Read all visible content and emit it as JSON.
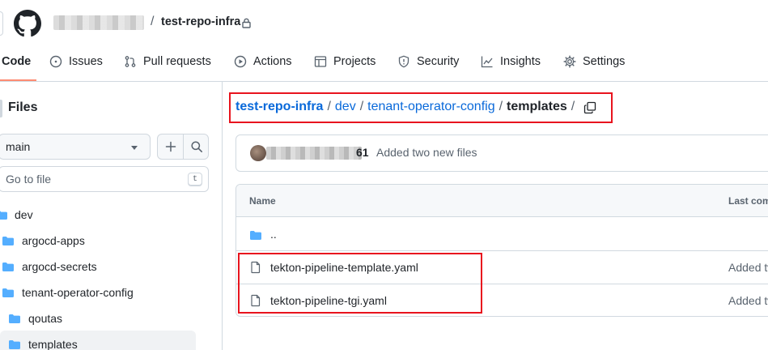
{
  "header": {
    "owner_blurred": "",
    "separator": "/",
    "repo_name": "test-repo-infra"
  },
  "nav": {
    "code": "Code",
    "issues": "Issues",
    "pull_requests": "Pull requests",
    "actions": "Actions",
    "projects": "Projects",
    "security": "Security",
    "insights": "Insights",
    "settings": "Settings"
  },
  "sidebar": {
    "title": "Files",
    "branch": "main",
    "goto_placeholder": "Go to file",
    "goto_shortcut": "t",
    "tree": [
      {
        "label": "dev"
      },
      {
        "label": "argocd-apps"
      },
      {
        "label": "argocd-secrets"
      },
      {
        "label": "tenant-operator-config"
      },
      {
        "label": "qoutas"
      },
      {
        "label": "templates"
      }
    ]
  },
  "breadcrumb": {
    "root": "test-repo-infra",
    "seg1": "dev",
    "seg2": "tenant-operator-config",
    "current": "templates",
    "sep": "/"
  },
  "commit": {
    "author_tail": "61",
    "message": "Added two new files"
  },
  "table": {
    "col_name": "Name",
    "col_last_commit": "Last com",
    "parent": "..",
    "rows": [
      {
        "name": "tekton-pipeline-template.yaml",
        "message": "Added tw"
      },
      {
        "name": "tekton-pipeline-tgi.yaml",
        "message": "Added tw"
      }
    ]
  },
  "colors": {
    "link": "#0969da",
    "folder": "#54aeff",
    "highlight_box": "#e8141e",
    "active_tab_underline": "#fd8c73"
  }
}
